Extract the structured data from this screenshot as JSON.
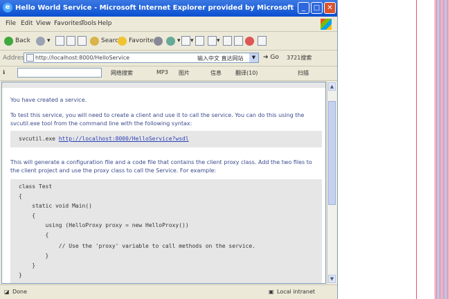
{
  "window": {
    "title": "Hello World Service - Microsoft Internet Explorer provided by Microsoft",
    "minimize": "_",
    "maximize": "□",
    "close": "✕"
  },
  "menu": [
    "File",
    "Edit",
    "View",
    "Favorites",
    "Tools",
    "Help"
  ],
  "toolbar": {
    "back": "Back",
    "search": "Search",
    "favorites": "Favorites"
  },
  "address": {
    "label": "Address",
    "url": "http://localhost:8000/HelloService",
    "extra": "输入中文 直达网站",
    "go": "Go",
    "links": "3721搜索"
  },
  "linksbar": {
    "items": [
      "网络搜索",
      "MP3",
      "图片",
      "信息",
      "翻译(10)",
      "扫描"
    ]
  },
  "page": {
    "p1": "You have created a service.",
    "p2": "To test this service, you will need to create a client and use it to call the service. You can do this using the svcutil.exe tool from the command line with the following syntax:",
    "cmd_prefix": "svcutil.exe ",
    "cmd_link": "http://localhost:8000/HelloService?wsdl",
    "p3": "This will generate a configuration file and a code file that contains the client proxy class. Add the two files to the client project and use the proxy class to call the Service. For example:",
    "code_lines": [
      "class Test",
      "{",
      "    static void Main()",
      "    {",
      "        using (HelloProxy proxy = new HelloProxy())",
      "        {",
      "            // Use the 'proxy' variable to call methods on the service.",
      "        }",
      "    }",
      "}"
    ]
  },
  "status": {
    "left": "Done",
    "right": "Local intranet"
  }
}
